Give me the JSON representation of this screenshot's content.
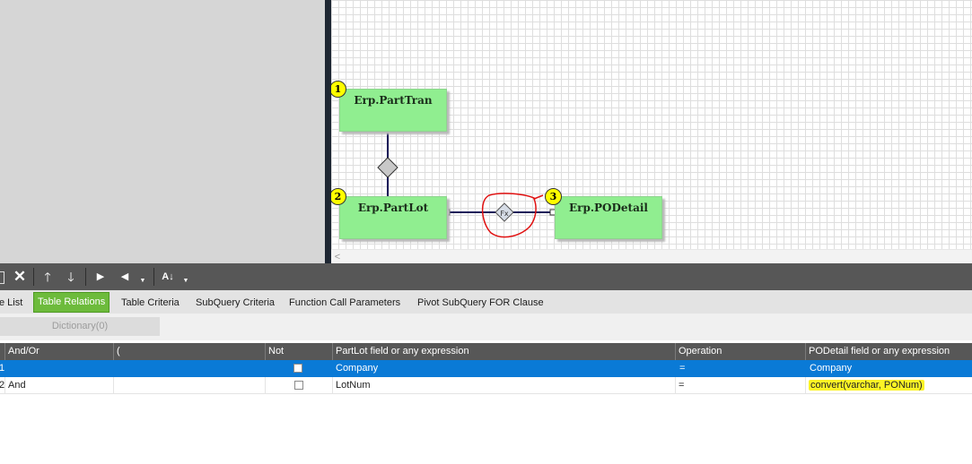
{
  "designer": {
    "tables": [
      {
        "badge": "1",
        "name": "Erp.PartTran"
      },
      {
        "badge": "2",
        "name": "Erp.PartLot"
      },
      {
        "badge": "3",
        "name": "Erp.PODetail"
      }
    ],
    "fx_label": "Fx",
    "scroll_left_glyph": "<"
  },
  "toolbar": {
    "buttons": [
      "delete-icon",
      "move-up-icon",
      "move-down-icon",
      "next-icon",
      "previous-icon",
      "sort-az-icon"
    ]
  },
  "tabs": [
    {
      "label": "e List",
      "active": false
    },
    {
      "label": "Table Relations",
      "active": true
    },
    {
      "label": "Table Criteria",
      "active": false
    },
    {
      "label": "SubQuery Criteria",
      "active": false
    },
    {
      "label": "Function Call Parameters",
      "active": false
    },
    {
      "label": "Pivot SubQuery FOR Clause",
      "active": false
    }
  ],
  "subtab": {
    "label": "Dictionary(0)"
  },
  "grid": {
    "columns": [
      "And/Or",
      "(",
      "Not",
      "PartLot field or any expression",
      "Operation",
      "PODetail field or any expression"
    ],
    "rows": [
      {
        "num": "1",
        "andor": "",
        "paren": "",
        "not": false,
        "left": "Company",
        "op": "=",
        "right": "Company",
        "selected": true
      },
      {
        "num": "2",
        "andor": "And",
        "paren": "",
        "not": false,
        "left": "LotNum",
        "op": "=",
        "right": "convert(varchar, PONum)",
        "selected": false
      }
    ]
  },
  "colors": {
    "accent": "#6dbb3c",
    "selection": "#0a7ad6",
    "table_fill": "#90ee90",
    "highlight": "#fbf325",
    "annotation": "#e01010"
  }
}
